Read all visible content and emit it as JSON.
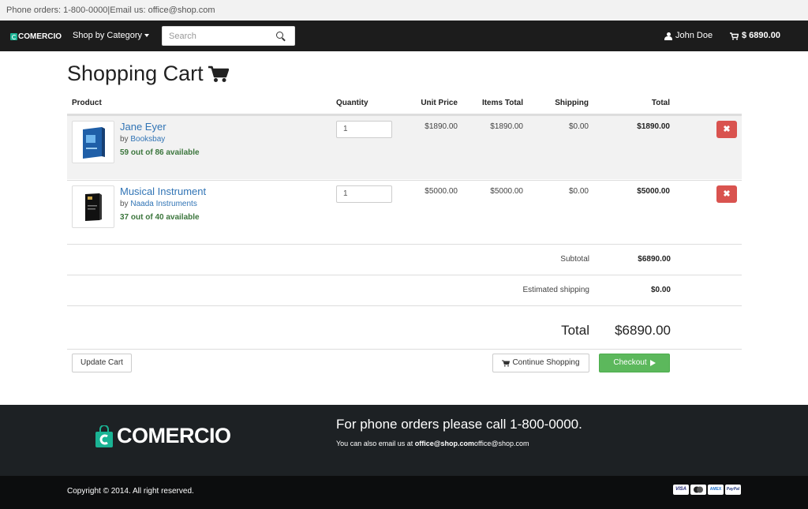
{
  "topbar": {
    "contact_text": "Phone orders: 1-800-0000|Email us: office@shop.com"
  },
  "navbar": {
    "brand": "COMERCIO",
    "shop_by_category": "Shop by Category",
    "search_placeholder": "Search",
    "user_name": "John Doe",
    "cart_total": "$ 6890.00"
  },
  "page": {
    "title": "Shopping Cart"
  },
  "table": {
    "headers": {
      "product": "Product",
      "quantity": "Quantity",
      "unit_price": "Unit Price",
      "items_total": "Items Total",
      "shipping": "Shipping",
      "total": "Total"
    },
    "rows": [
      {
        "name": "Jane Eyer",
        "by_prefix": "by",
        "seller": "Booksbay",
        "availability": "59 out of 86 available",
        "quantity": "1",
        "unit_price": "$1890.00",
        "items_total": "$1890.00",
        "shipping": "$0.00",
        "total": "$1890.00",
        "delete_label": "✖"
      },
      {
        "name": "Musical Instrument",
        "by_prefix": "by",
        "seller": "Naada Instruments",
        "availability": "37 out of 40 available",
        "quantity": "1",
        "unit_price": "$5000.00",
        "items_total": "$5000.00",
        "shipping": "$0.00",
        "total": "$5000.00",
        "delete_label": "✖"
      }
    ]
  },
  "summary": {
    "subtotal_label": "Subtotal",
    "subtotal_value": "$6890.00",
    "shipping_label": "Estimated shipping",
    "shipping_value": "$0.00",
    "total_label": "Total",
    "total_value": "$6890.00"
  },
  "actions": {
    "update_cart": "Update Cart",
    "continue_shopping": "Continue Shopping",
    "checkout": "Checkout"
  },
  "footer": {
    "brand": "COMERCIO",
    "phone_line": "For phone orders please call 1-800-0000.",
    "email_prefix": "You can also email us at",
    "email_bold": "office@shop.com",
    "email_suffix": "office@shop.com",
    "copyright": "Copyright © 2014. All right reserved.",
    "payment_cards": [
      "VISA",
      "MC",
      "AMEX",
      "PayPal"
    ]
  },
  "colors": {
    "brand_teal": "#1ab394",
    "link_blue": "#3174b5",
    "stock_green": "#3c763d",
    "danger_red": "#d9534f",
    "checkout_green": "#5cb85c",
    "nav_dark": "#1c1c1c",
    "footer_dark": "#1d2124"
  }
}
